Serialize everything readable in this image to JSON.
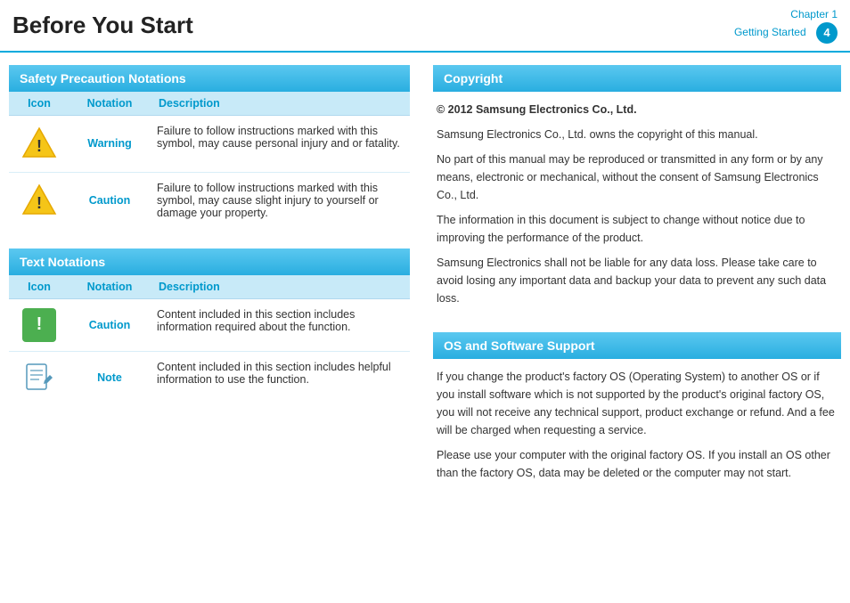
{
  "header": {
    "title": "Before You Start",
    "chapter_label": "Chapter 1",
    "chapter_sub": "Getting Started",
    "chapter_num": "4"
  },
  "left": {
    "safety_section_title": "Safety Precaution Notations",
    "safety_table": {
      "col_icon": "Icon",
      "col_notation": "Notation",
      "col_description": "Description",
      "rows": [
        {
          "icon": "warning-triangle",
          "notation": "Warning",
          "description": "Failure to follow instructions marked with this symbol, may cause personal injury and or fatality."
        },
        {
          "icon": "caution-triangle",
          "notation": "Caution",
          "description": "Failure to follow instructions marked with this symbol, may cause slight injury to yourself or damage your property."
        }
      ]
    },
    "text_section_title": "Text Notations",
    "text_table": {
      "col_icon": "Icon",
      "col_notation": "Notation",
      "col_description": "Description",
      "rows": [
        {
          "icon": "green-exclamation",
          "notation": "Caution",
          "description": "Content included in this section includes information required about the function."
        },
        {
          "icon": "note-pencil",
          "notation": "Note",
          "description": "Content included in this section includes helpful information to use the function."
        }
      ]
    }
  },
  "right": {
    "copyright_title": "Copyright",
    "copyright_bold": "© 2012 Samsung Electronics Co., Ltd.",
    "copyright_paragraphs": [
      "Samsung Electronics Co., Ltd. owns the copyright of this manual.",
      "No part of this manual may be reproduced or transmitted in any form or by any means, electronic or mechanical, without the consent of Samsung Electronics Co., Ltd.",
      "The information in this document is subject to change without notice due to improving the performance of the product.",
      "Samsung Electronics shall not be liable for any data loss. Please take care to avoid losing any important data and backup your data to prevent any such data loss."
    ],
    "os_title": "OS and Software Support",
    "os_paragraphs": [
      "If you change the product's factory OS (Operating System) to another OS or if you install software which is not supported by the product's original factory OS, you will not receive any technical support, product exchange or refund. And a fee will be charged when requesting a service.",
      "Please use your computer with the original factory OS. If you install an OS other than the factory OS, data may be deleted or the computer may not start."
    ]
  }
}
